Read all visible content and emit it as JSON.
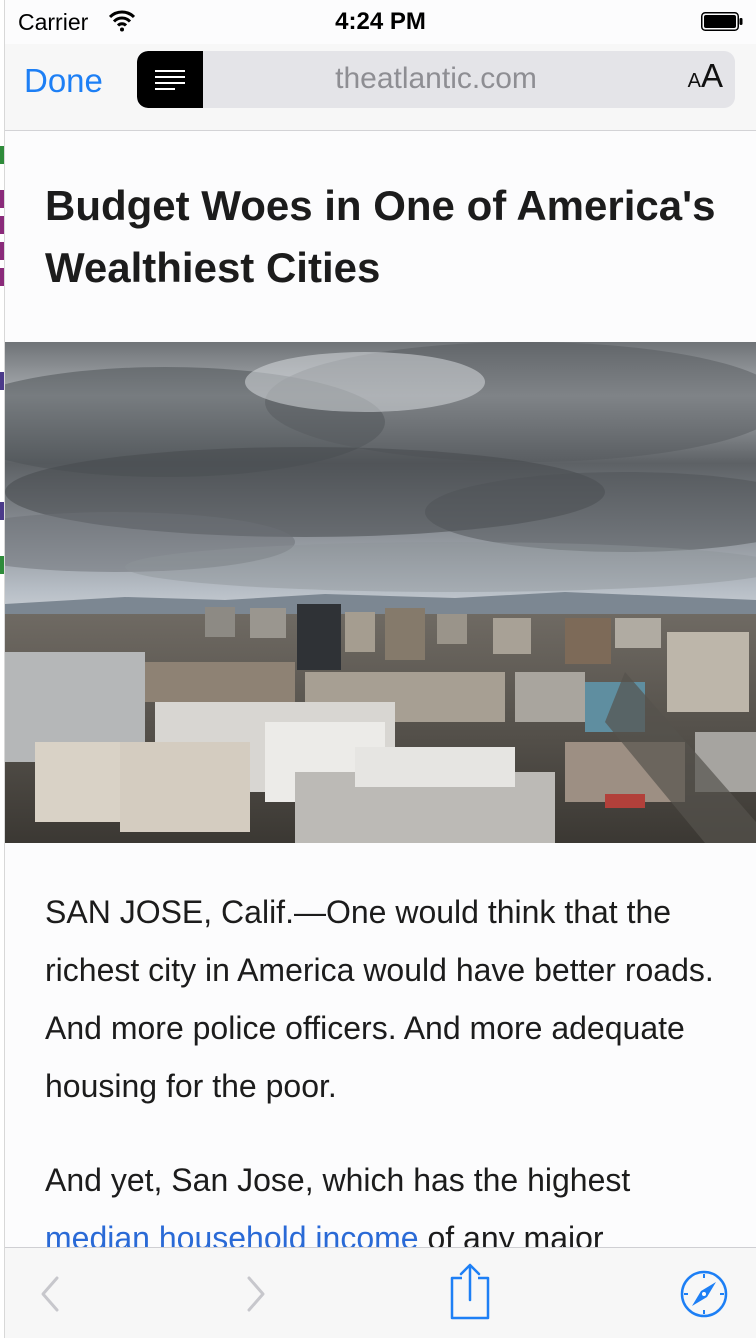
{
  "status_bar": {
    "carrier": "Carrier",
    "time": "4:24 PM"
  },
  "nav_bar": {
    "done_label": "Done",
    "url": "theatlantic.com",
    "text_size_small": "A",
    "text_size_large": "A"
  },
  "article": {
    "headline": "Budget Woes in One of America's Wealthiest Cities",
    "paragraph_1": "SAN JOSE, Calif.—One would think that the richest city in America would have better roads. And more police officers. And more adequate housing for the poor.",
    "paragraph_2_start": "And yet, San Jose, which has the highest ",
    "paragraph_2_link": "median household income",
    "paragraph_2_end": " of any major",
    "hero_image": "aerial view of downtown San Jose under a cloudy sky"
  },
  "toolbar": {
    "back_icon": "chevron-left-icon",
    "forward_icon": "chevron-right-icon",
    "share_icon": "share-icon",
    "safari_icon": "compass-icon"
  },
  "colors": {
    "accent": "#1d7ff5",
    "link": "#2a6ad6",
    "text": "#1c1c1c",
    "url_text": "#8e8e93",
    "disabled": "#c7c7cc"
  }
}
